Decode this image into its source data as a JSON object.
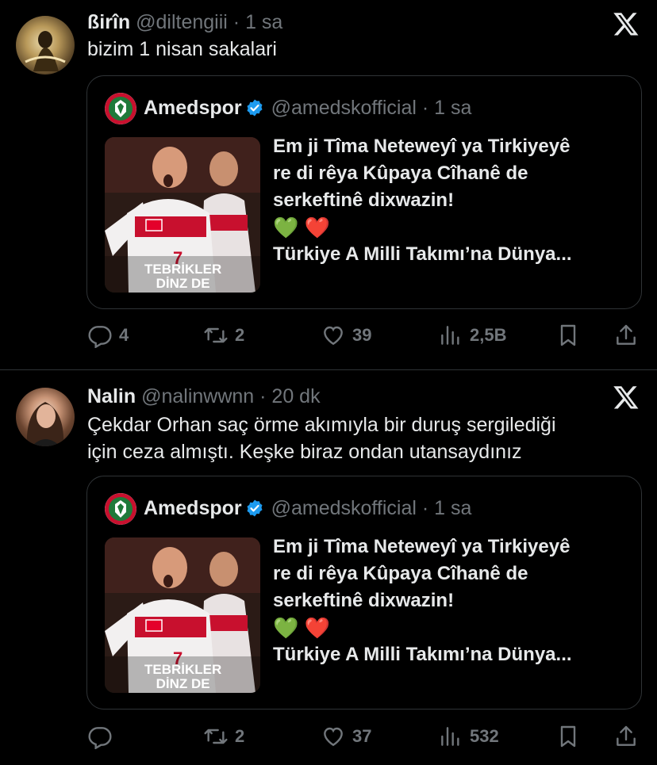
{
  "tweets": [
    {
      "display_name": "ßirîn",
      "handle": "@diltengiii",
      "time": "· 1 sa",
      "text_lines": [
        "bizim 1 nisan sakalari"
      ],
      "quote": {
        "display_name": "Amedspor",
        "handle": "@amedskofficial",
        "time": "· 1 sa",
        "lines": [
          "Em ji Tîma Neteweyî ya Tirkiyeyê",
          "re di rêya Kûpaya Cîhanê de",
          "serkeftinê dixwazin!",
          "💚 ❤️",
          "Türkiye A Milli Takımı’na Dünya..."
        ],
        "image_caption_1": "TEBRİKLER",
        "image_caption_2": "DİNZ DE"
      },
      "counts": {
        "reply": "4",
        "retweet": "2",
        "like": "39",
        "views": "2,5B"
      }
    },
    {
      "display_name": "Nalin",
      "handle": "@nalinwwnn",
      "time": "· 20 dk",
      "text_lines": [
        "Çekdar Orhan saç örme akımıyla bir duruş sergilediği",
        "için ceza almıştı. Keşke biraz ondan utansaydınız"
      ],
      "quote": {
        "display_name": "Amedspor",
        "handle": "@amedskofficial",
        "time": "· 1 sa",
        "lines": [
          "Em ji Tîma Neteweyî ya Tirkiyeyê",
          "re di rêya Kûpaya Cîhanê de",
          "serkeftinê dixwazin!",
          "💚 ❤️",
          "Türkiye A Milli Takımı’na Dünya..."
        ],
        "image_caption_1": "TEBRİKLER",
        "image_caption_2": "DİNZ DE"
      },
      "counts": {
        "reply": "",
        "retweet": "2",
        "like": "37",
        "views": "532"
      }
    }
  ],
  "colors": {
    "background": "#000000",
    "text": "#e7e9ea",
    "muted": "#71767b",
    "border": "#2f3336",
    "verified": "#1d9bf0",
    "amed_green": "#1e7a3a",
    "amed_red": "#c8102e"
  },
  "icons": [
    "x-logo-icon",
    "verified-badge-icon",
    "reply-icon",
    "retweet-icon",
    "like-icon",
    "views-icon",
    "bookmark-icon",
    "share-icon"
  ]
}
